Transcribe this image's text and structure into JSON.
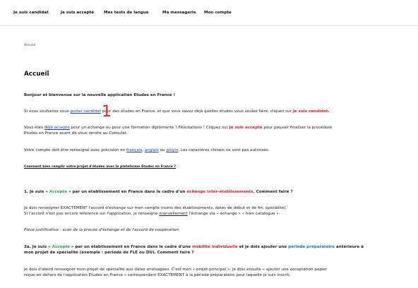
{
  "nav": {
    "items": [
      "Je suis candidat",
      "Je suis accepté",
      "Mes tests de langue",
      "Ma messagerie",
      "Mon compte"
    ]
  },
  "breadcrumb": "Accueil",
  "page_title": "Accueil",
  "intro": "Bonjour et bienvenue sur la nouvelle application Etudes en France !",
  "para1": {
    "a": "Si vous souhaitez vous ",
    "link": "porter candidat",
    "b": " pour des études en France, et que vous savez déjà quelles études vous voulez faire, cliquez sur ",
    "c": "Je suis candidat."
  },
  "para2": {
    "a": "Vous êtes ",
    "link": "déjà accepté",
    "b": " pour un échange ou pour une formation diplômante ? Félicitations ! Cliquez sur ",
    "c": "Je suis accepté",
    "d": " pour pouvoir finaliser la procédure",
    "line2": "Etudes en France avant de vous rendre au Consulat."
  },
  "para3": {
    "a": "Votre compte doit être renseigné avec précision en ",
    "l1": "français",
    "sep1": ", ",
    "l2": "anglais",
    "sep2": " ou ",
    "l3": "pinyin",
    "b": ". Les caractères chinois ne sont pas autorisés."
  },
  "howto_link": "Comment bien remplir votre projet d'études avec la plateforme Etudes en France ?",
  "s1": {
    "a": "1. Je suis « ",
    "g": "Accepté",
    "b": " » par un établissement en France dans le cadre d'un ",
    "r": "échange inter-établissements",
    "c": ". Comment faire ?"
  },
  "s1_body1": "Je dois renseigner EXACTEMENT l'accord d'échange sur mon compte (noms des établissements, dates de début et de fin, spécialité).",
  "s1_body2": {
    "a": "Si l'accord n'est pas encore référencé sur l'application, je renseigne ",
    "u": "manuellement",
    "b": " l'échange via « échange » « hors catalogue »."
  },
  "s1_proof": "Pièce justificative : scan de la preuve d'échange et de l'accord de coopération",
  "s2a": {
    "a": "2a. Je suis « ",
    "g": "Accepté",
    "b": " » par un établissement en France dans le cadre d'une ",
    "r": "mobilité individuelle",
    "c": " et je dois ajouter une ",
    "bl": "période préparatoire",
    "d": " antérieure à",
    "line2": "mon projet de spécialité (exemple : période de FLE ou DU). Comment faire ?"
  },
  "s2a_body1": "Je dois d'abord renseigner mon projet de spécialité aux dates envisagées. C'est mon « projet principal ». Je dois ensuite « ajouter une acceptation papier",
  "s2a_body2": "reçue en dehors de l'application Etudes en France » correspondant EXACTEMENT à la période préparatoire pour laquelle je suis inscrit.",
  "annotation": "1"
}
